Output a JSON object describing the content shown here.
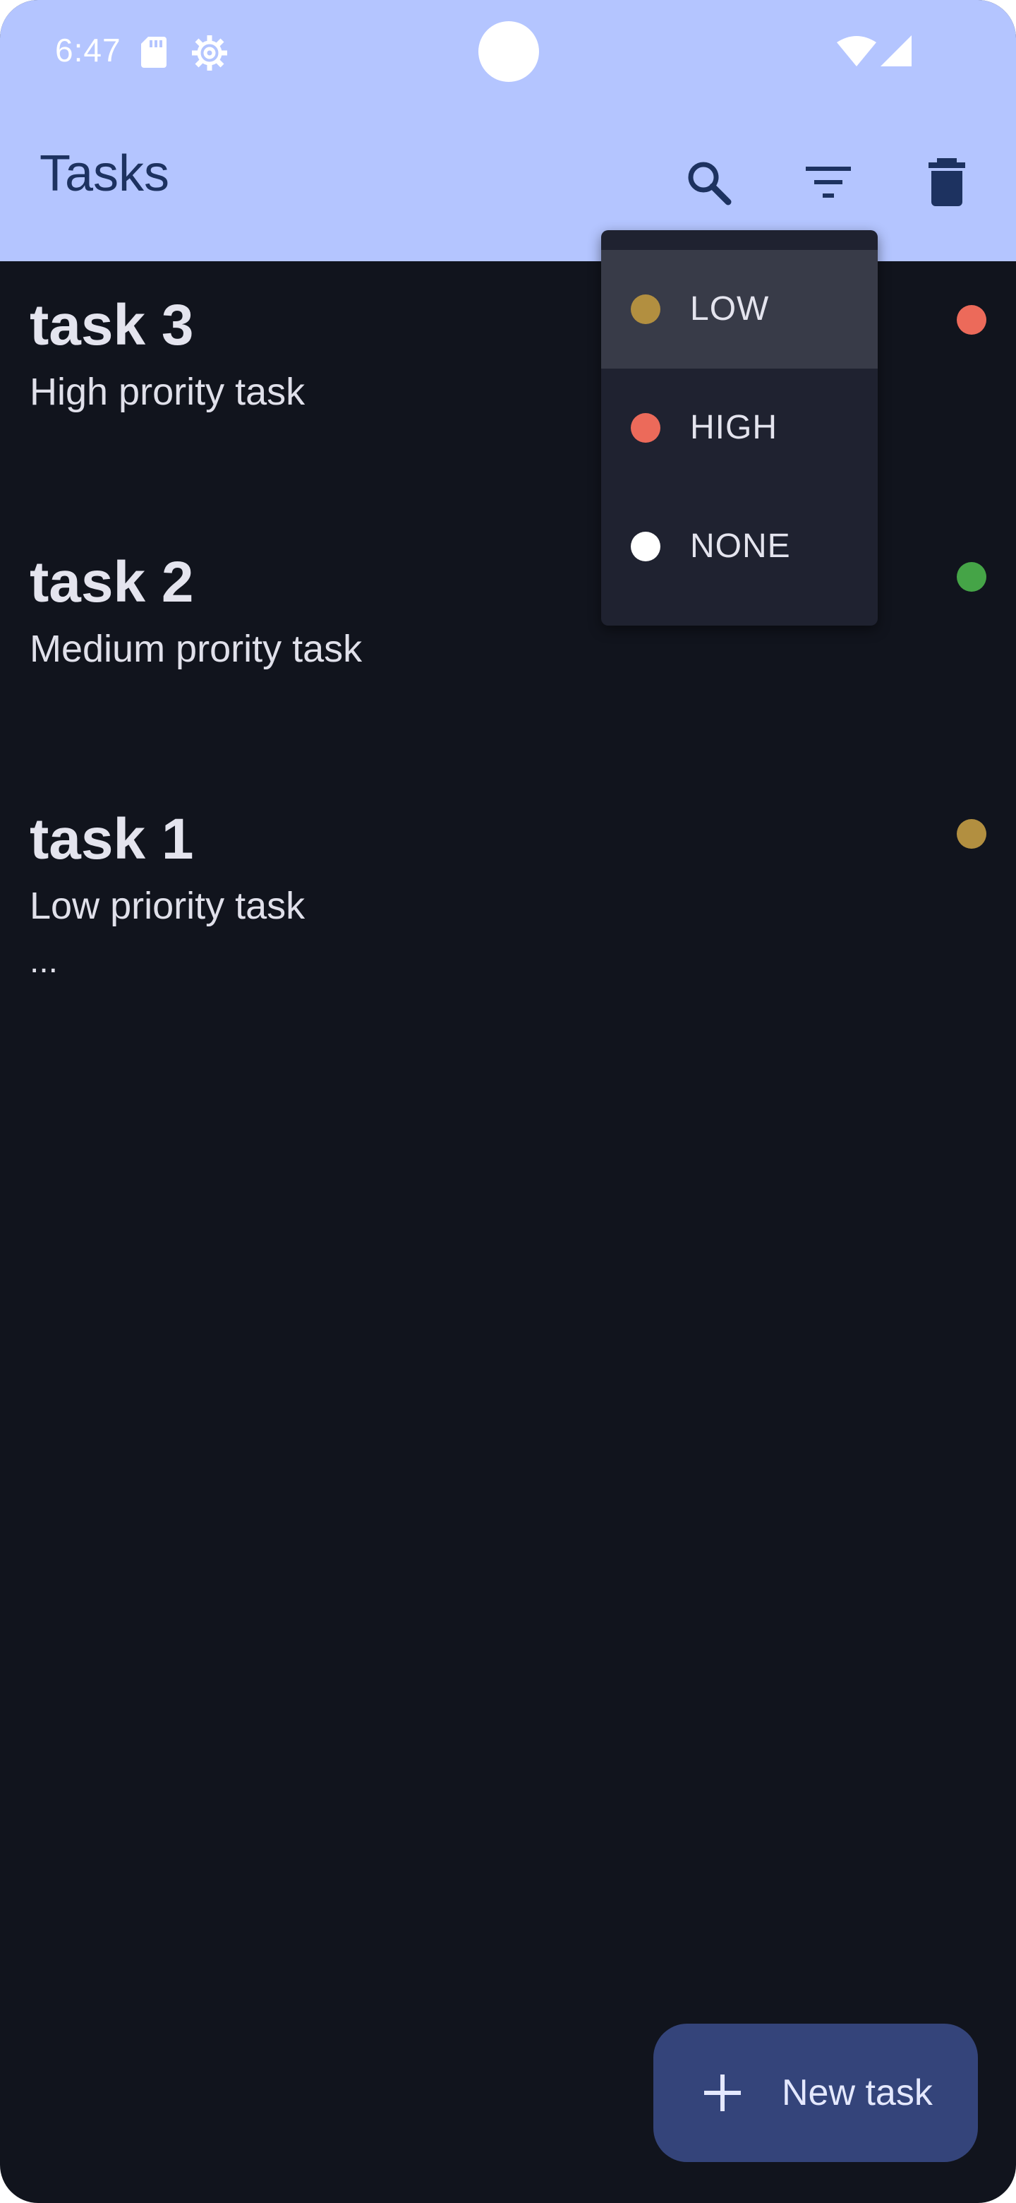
{
  "status_bar": {
    "time": "6:47",
    "icons": [
      "sd-card-icon",
      "gear-icon",
      "wifi-icon",
      "signal-icon"
    ]
  },
  "app_bar": {
    "title": "Tasks",
    "actions": [
      "search-icon",
      "filter-icon",
      "delete-icon"
    ]
  },
  "tasks": [
    {
      "title": "task 3",
      "description": "High prority task",
      "priority_color": "#ec6a5a"
    },
    {
      "title": "task 2",
      "description": "Medium prority task",
      "priority_color": "#45a447"
    },
    {
      "title": "task 1",
      "description": "Low priority task",
      "more": "...",
      "priority_color": "#b28f40"
    }
  ],
  "priority_menu": {
    "items": [
      {
        "label": "LOW",
        "color": "#b28f40",
        "highlighted": true
      },
      {
        "label": "HIGH",
        "color": "#ec6a5a",
        "highlighted": false
      },
      {
        "label": "NONE",
        "color": "#ffffff",
        "highlighted": false
      }
    ]
  },
  "fab": {
    "label": "New task",
    "icon": "plus-icon"
  },
  "colors": {
    "app_bar": "#b4c5ff",
    "background": "#11141d",
    "menu": "#1f2230",
    "fab": "#34447a"
  }
}
